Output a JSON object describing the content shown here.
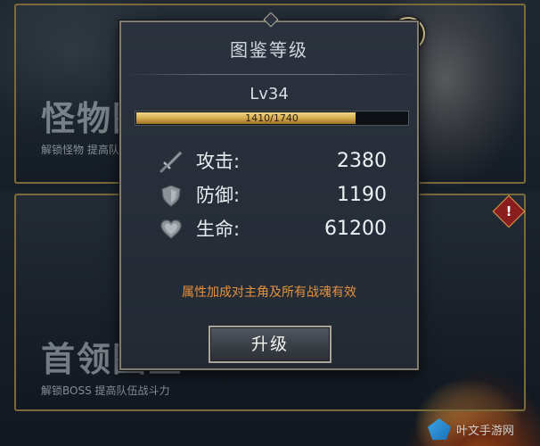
{
  "dialog": {
    "title": "图鉴等级",
    "level": "Lv34",
    "xp": {
      "text": "1410/1740",
      "current": 1410,
      "max": 1740
    },
    "stats": [
      {
        "icon": "sword-icon",
        "label": "攻击:",
        "value": "2380"
      },
      {
        "icon": "shield-icon",
        "label": "防御:",
        "value": "1190"
      },
      {
        "icon": "heart-icon",
        "label": "生命:",
        "value": "61200"
      }
    ],
    "note": "属性加成对主角及所有战魂有效",
    "upgrade_label": "升级"
  },
  "background": {
    "top_card": {
      "title": "怪物图鉴",
      "subtitle": "解锁怪物 提高队伍"
    },
    "bottom_card": {
      "title": "首领图鉴",
      "subtitle": "解锁BOSS 提高队伍战斗力"
    },
    "alert_badge": "!",
    "watermark": "叶文手游网"
  },
  "colors": {
    "accent_gold": "#d6ab4f",
    "note_orange": "#e3913e",
    "frame_gold": "#7b6a3c"
  }
}
